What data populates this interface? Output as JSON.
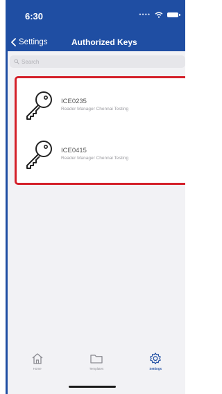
{
  "status": {
    "time": "6:30"
  },
  "nav": {
    "back_label": "Settings",
    "title": "Authorized Keys"
  },
  "search": {
    "placeholder": "Search"
  },
  "keys": [
    {
      "id": "ICE0235",
      "subtitle": "Reader Manager Chennai Testing"
    },
    {
      "id": "ICE0415",
      "subtitle": "Reader Manager Chennai Testing"
    }
  ],
  "tabs": [
    {
      "label": "Home",
      "icon": "home-icon"
    },
    {
      "label": "Templates",
      "icon": "folder-icon"
    },
    {
      "label": "Settings",
      "icon": "gear-icon",
      "active": true
    }
  ],
  "colors": {
    "primary": "#1f4ea3",
    "highlight": "#d4202a"
  }
}
